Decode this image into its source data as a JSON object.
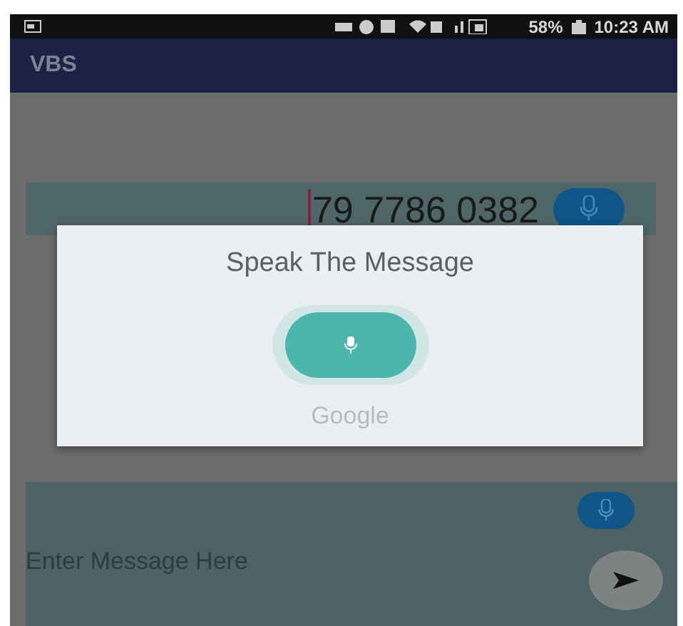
{
  "status_bar": {
    "battery": "58%",
    "time": "10:23 AM"
  },
  "app_bar": {
    "title": "VBS"
  },
  "phone_field": {
    "value": "79 7786 0382"
  },
  "message_field": {
    "placeholder": "Enter Message Here"
  },
  "dialog": {
    "title": "Speak The Message",
    "brand": "Google"
  }
}
